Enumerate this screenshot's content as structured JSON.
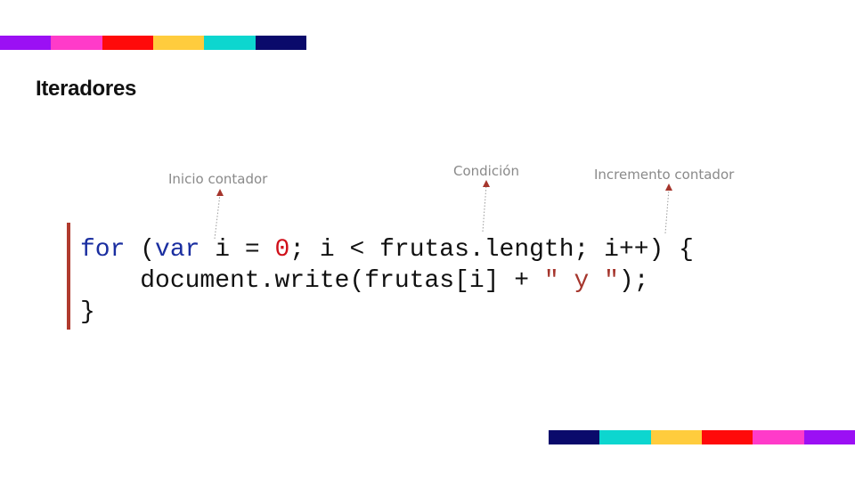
{
  "slide": {
    "title": "Iteradores"
  },
  "decor": {
    "stripe_colors": [
      "#9b10f4",
      "#ff3bc9",
      "#ff0a0a",
      "#ffcc3d",
      "#0dd6cf",
      "#0a0a6b"
    ]
  },
  "annotations": {
    "start": "Inicio contador",
    "condition": "Condición",
    "increment": "Incremento contador",
    "arrow_color": "#a5352c"
  },
  "code": {
    "accent_color": "#b03a2e",
    "line1": {
      "kw_for": "for",
      "paren": " (",
      "kw_var": "var",
      "init": " i = ",
      "zero": "0",
      "rest": "; i < frutas.length; i++) {"
    },
    "line2": {
      "indent": "    ",
      "call": "document.write(frutas[i] + ",
      "string": "\" y \"",
      "end": ");"
    },
    "line3": {
      "close": "}"
    }
  }
}
